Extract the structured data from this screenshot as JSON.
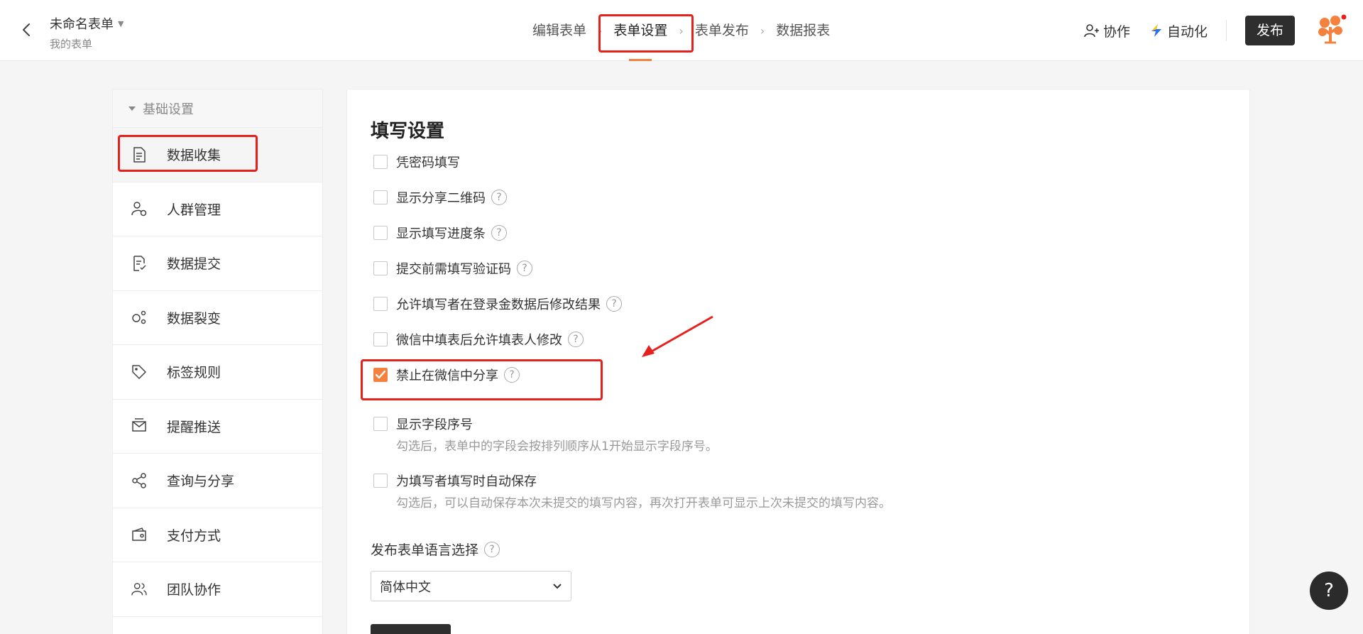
{
  "header": {
    "form_title": "未命名表单",
    "form_subtitle": "我的表单",
    "steps": [
      "编辑表单",
      "表单设置",
      "表单发布",
      "数据报表"
    ],
    "active_step": 1,
    "collab_label": "协作",
    "automation_label": "自动化",
    "publish_label": "发布"
  },
  "sidebar": {
    "group_label": "基础设置",
    "items": [
      {
        "label": "数据收集",
        "icon": "document-icon"
      },
      {
        "label": "人群管理",
        "icon": "user-settings-icon"
      },
      {
        "label": "数据提交",
        "icon": "submit-document-icon"
      },
      {
        "label": "数据裂变",
        "icon": "fission-icon"
      },
      {
        "label": "标签规则",
        "icon": "tag-icon"
      },
      {
        "label": "提醒推送",
        "icon": "notification-icon"
      },
      {
        "label": "查询与分享",
        "icon": "share-icon"
      },
      {
        "label": "支付方式",
        "icon": "wallet-icon"
      },
      {
        "label": "团队协作",
        "icon": "team-icon"
      }
    ],
    "active_index": 0
  },
  "main": {
    "section_title": "填写设置",
    "options": [
      {
        "label": "凭密码填写",
        "checked": false,
        "help": false
      },
      {
        "label": "显示分享二维码",
        "checked": false,
        "help": true
      },
      {
        "label": "显示填写进度条",
        "checked": false,
        "help": true
      },
      {
        "label": "提交前需填写验证码",
        "checked": false,
        "help": true
      },
      {
        "label": "允许填写者在登录金数据后修改结果",
        "checked": false,
        "help": true
      },
      {
        "label": "微信中填表后允许填表人修改",
        "checked": false,
        "help": true
      },
      {
        "label": "禁止在微信中分享",
        "checked": true,
        "help": true
      },
      {
        "label": "显示字段序号",
        "checked": false,
        "help": false,
        "description": "勾选后，表单中的字段会按排列顺序从1开始显示字段序号。"
      },
      {
        "label": "为填写者填写时自动保存",
        "checked": false,
        "help": false,
        "description": "勾选后，可以自动保存本次未提交的填写内容，再次打开表单可显示上次未提交的填写内容。"
      }
    ],
    "language_label": "发布表单语言选择",
    "language_selected": "简体中文"
  },
  "help_fab": "?",
  "colors": {
    "accent": "#f5813f",
    "annotation": "#e5201d",
    "dark_button": "#2e2e2e"
  }
}
